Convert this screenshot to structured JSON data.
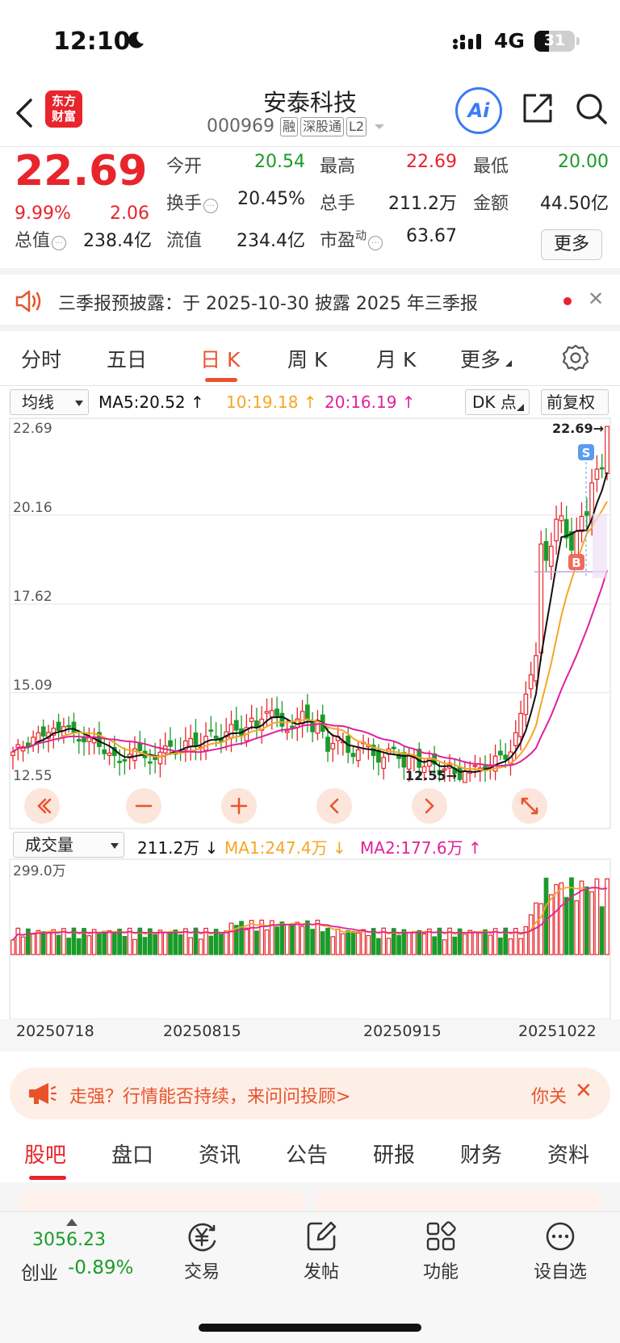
{
  "status_bar": {
    "time": "12:10",
    "network": "4G",
    "battery": "31"
  },
  "header": {
    "stock_name": "安泰科技",
    "stock_code": "000969",
    "tags": [
      "融",
      "深股通",
      "L2"
    ],
    "logo_text": [
      "东方",
      "财富"
    ],
    "ai_label": "Ai"
  },
  "quote": {
    "price": "22.69",
    "change_pct": "9.99%",
    "change": "2.06",
    "rows": [
      [
        {
          "label": "今开",
          "value": "20.54",
          "color": "green"
        },
        {
          "label": "最高",
          "value": "22.69",
          "color": "red"
        },
        {
          "label": "最低",
          "value": "20.00",
          "color": "green"
        }
      ],
      [
        {
          "label": "换手",
          "value": "20.45%",
          "color": "black"
        },
        {
          "label": "总手",
          "value": "211.2万",
          "color": "black"
        },
        {
          "label": "金额",
          "value": "44.50亿",
          "color": "black"
        }
      ],
      [
        {
          "label": "总值",
          "value": "238.4亿",
          "color": "black"
        },
        {
          "label": "流值",
          "value": "234.4亿",
          "color": "black"
        },
        {
          "label": "市盈",
          "value": "63.67",
          "color": "black",
          "sup": "动"
        }
      ]
    ],
    "more_label": "更多"
  },
  "notice": {
    "text": "三季报预披露：于 2025-10-30 披露 2025 年三季报"
  },
  "period_tabs": [
    "分时",
    "五日",
    "日 K",
    "周 K",
    "月 K",
    "更多"
  ],
  "period_active": 2,
  "ma_row": {
    "indicator": "均线",
    "ma5": "MA5:20.52",
    "ma10": "10:19.18",
    "ma20": "20:16.19",
    "dk_label": "DK 点",
    "adjust_label": "前复权",
    "colors": {
      "ma5": "#111111",
      "ma10": "#f5a623",
      "ma20": "#e0219c"
    }
  },
  "chart_data": {
    "type": "candlestick",
    "y_ticks": [
      "22.69",
      "20.16",
      "17.62",
      "15.09",
      "12.55"
    ],
    "ylim": [
      12.55,
      22.69
    ],
    "high_label": "22.69→",
    "low_label": "12.55→",
    "buy_marker": "B",
    "sell_marker": "S",
    "volume": {
      "indicator": "成交量",
      "value": "211.2万",
      "ma1": "MA1:247.4万",
      "ma2": "MA2:177.6万",
      "max_label": "299.0万",
      "max": 299.0
    },
    "x_labels": [
      "20250718",
      "20250815",
      "20250915",
      "20251022"
    ]
  },
  "advisor": {
    "text": "走强？行情能否持续，来问问投顾>",
    "tail": "你关"
  },
  "content_tabs": [
    "股吧",
    "盘口",
    "资讯",
    "公告",
    "研报",
    "财务",
    "资料"
  ],
  "content_active": 0,
  "bottom_bar": {
    "index_value": "3056.23",
    "index_name": "创业",
    "index_pct": "-0.89%",
    "items": [
      {
        "label": "交易",
        "icon": "yen-trade-icon"
      },
      {
        "label": "发帖",
        "icon": "edit-post-icon"
      },
      {
        "label": "功能",
        "icon": "grid-function-icon"
      },
      {
        "label": "设自选",
        "icon": "add-watchlist-icon"
      }
    ]
  }
}
